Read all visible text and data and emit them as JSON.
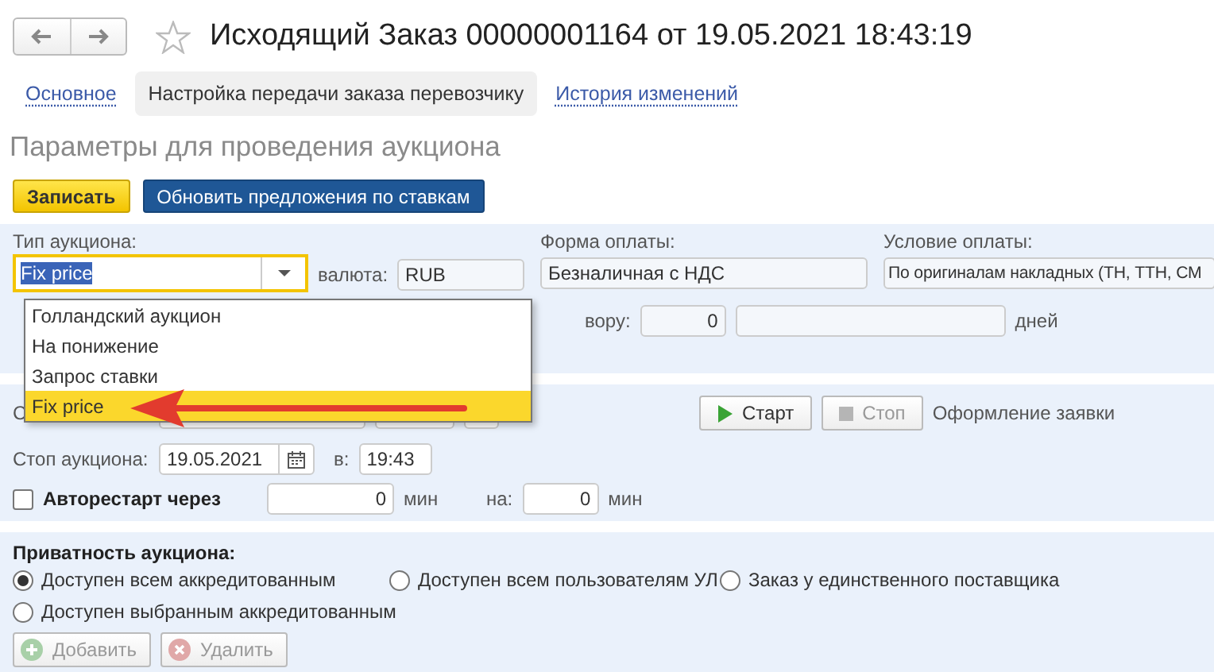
{
  "window": {
    "title": "Исходящий Заказ 00000001164 от 19.05.2021 18:43:19",
    "favorite": false
  },
  "tabs": [
    {
      "label": "Основное",
      "selected": false
    },
    {
      "label": "Настройка передачи заказа перевозчику",
      "selected": true
    },
    {
      "label": "История изменений",
      "selected": false
    }
  ],
  "heading": "Параметры для проведения аукциона",
  "toolbar": [
    {
      "label": "Записать",
      "kind": "primary"
    },
    {
      "label": "Обновить предложения по ставкам",
      "kind": "blue"
    }
  ],
  "terms": {
    "auction_type": {
      "label": "Тип аукциона:",
      "value": "Fix price"
    },
    "currency": {
      "label": "валюта:",
      "value": "RUB"
    },
    "payment_form": {
      "label": "Форма оплаты:",
      "value": "Безналичная с НДС"
    },
    "payment_condition": {
      "label": "Условие оплаты:",
      "value": "По оригиналам накладных (ТН, ТТН, СМ"
    },
    "deferral": {
      "label": "вору:",
      "value": "0",
      "unit": "дней"
    }
  },
  "dropdown": {
    "items": [
      {
        "label": "Голландский аукцион",
        "selected": false
      },
      {
        "label": "На понижение",
        "selected": false
      },
      {
        "label": "Запрос ставки",
        "selected": false
      },
      {
        "label": "Fix price",
        "selected": true
      }
    ]
  },
  "schedule": {
    "start_label": "С",
    "start_button": {
      "label": "Старт",
      "disabled": false
    },
    "stop_button": {
      "label": "Стоп",
      "disabled": true
    },
    "status": "Оформление заявки",
    "stop_label": "Стоп аукциона:",
    "stop_date": "19.05.2021",
    "at_label": "в:",
    "stop_time": "19:43",
    "autorestart": {
      "label": "Авторестарт через",
      "checked": false,
      "value": "0",
      "unit": "мин",
      "on_label": "на:",
      "on_value": "0",
      "on_unit": "мин"
    }
  },
  "privacy": {
    "title": "Приватность аукциона:",
    "options": [
      {
        "label": "Доступен всем аккредитованным",
        "selected": true
      },
      {
        "label": "Доступен всем пользователям УЛ",
        "selected": false
      },
      {
        "label": "Заказ у единственного поставщика",
        "selected": false
      },
      {
        "label": "Доступен выбранным аккредитованным",
        "selected": false
      }
    ],
    "buttons": [
      {
        "label": "Добавить",
        "disabled": true,
        "kind": "add"
      },
      {
        "label": "Удалить",
        "disabled": true,
        "kind": "delete"
      }
    ]
  }
}
